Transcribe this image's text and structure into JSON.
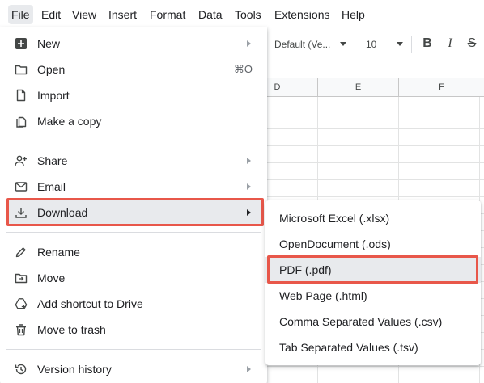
{
  "menubar": {
    "items": [
      {
        "label": "File"
      },
      {
        "label": "Edit"
      },
      {
        "label": "View"
      },
      {
        "label": "Insert"
      },
      {
        "label": "Format"
      },
      {
        "label": "Data"
      },
      {
        "label": "Tools"
      },
      {
        "label": "Extensions"
      },
      {
        "label": "Help"
      }
    ]
  },
  "toolbar": {
    "font_family": "Default (Ve...",
    "font_size": "10",
    "bold_label": "B",
    "italic_label": "I",
    "strike_label": "S"
  },
  "grid": {
    "columns": [
      "D",
      "E",
      "F"
    ]
  },
  "file_menu": {
    "items": [
      {
        "label": "New",
        "icon": "plus-box-icon",
        "submenu": true
      },
      {
        "label": "Open",
        "icon": "folder-icon",
        "shortcut": "⌘O"
      },
      {
        "label": "Import",
        "icon": "file-icon"
      },
      {
        "label": "Make a copy",
        "icon": "copy-icon"
      },
      {
        "label": "Share",
        "icon": "person-add-icon",
        "submenu": true
      },
      {
        "label": "Email",
        "icon": "mail-icon",
        "submenu": true
      },
      {
        "label": "Download",
        "icon": "download-icon",
        "submenu": true,
        "highlighted": true
      },
      {
        "label": "Rename",
        "icon": "pencil-icon"
      },
      {
        "label": "Move",
        "icon": "move-folder-icon"
      },
      {
        "label": "Add shortcut to Drive",
        "icon": "drive-shortcut-icon"
      },
      {
        "label": "Move to trash",
        "icon": "trash-icon"
      },
      {
        "label": "Version history",
        "icon": "history-icon",
        "submenu": true
      }
    ]
  },
  "download_submenu": {
    "items": [
      {
        "label": "Microsoft Excel (.xlsx)"
      },
      {
        "label": "OpenDocument (.ods)"
      },
      {
        "label": "PDF (.pdf)",
        "highlighted": true
      },
      {
        "label": "Web Page (.html)"
      },
      {
        "label": "Comma Separated Values (.csv)"
      },
      {
        "label": "Tab Separated Values (.tsv)"
      }
    ]
  },
  "colors": {
    "callout": "#e8574a",
    "highlight": "#e8eaed",
    "text": "#202124",
    "icon": "#444746"
  }
}
